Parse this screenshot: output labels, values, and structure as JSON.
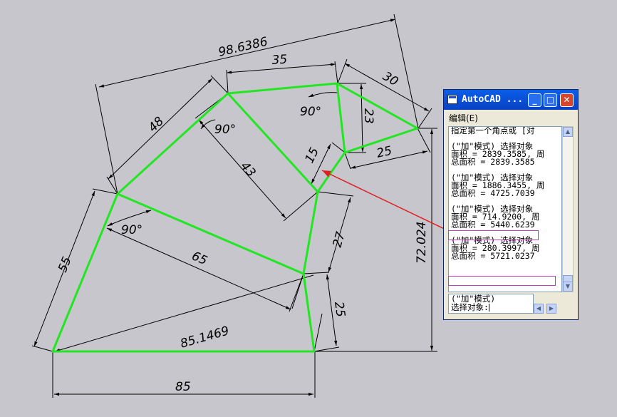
{
  "drawing": {
    "dimensions": {
      "top_overall": "98.6386",
      "top_edge": "35",
      "top_right": "30",
      "left_upper": "48",
      "angle_upper": "90°",
      "angle_top": "90°",
      "inner_diag": "43",
      "small_15": "15",
      "right_23": "23",
      "right_25_upper": "25",
      "angle_left": "90°",
      "mid_65": "65",
      "right_27": "27",
      "left_55": "55",
      "vertical_total": "72.024",
      "right_25_lower": "25",
      "bottom_slant": "85.1469",
      "bottom_85": "85"
    },
    "shape_color": "#22e622",
    "callout_arrow_color": "#e02020"
  },
  "window": {
    "title": "AutoCAD ...",
    "menu_edit": "编辑(E)",
    "output_lines": [
      "指定第一个角点或 [对",
      "",
      "(\"加\"模式) 选择对象",
      "面积 = 2839.3585, 周",
      "总面积 = 2839.3585",
      "",
      "(\"加\"模式) 选择对象",
      "面积 = 1886.3455, 周",
      "总面积 = 4725.7039",
      "",
      "(\"加\"模式) 选择对象",
      "面积 = 714.9200, 周",
      "总面积 = 5440.6239",
      "",
      "(\"加\"模式) 选择对象",
      "面积 = 280.3997, 周",
      "总面积 = 5721.0237"
    ],
    "cmd_lines": [
      "(\"加\"模式)",
      "选择对象:"
    ],
    "highlight_color": "#c040c0"
  }
}
